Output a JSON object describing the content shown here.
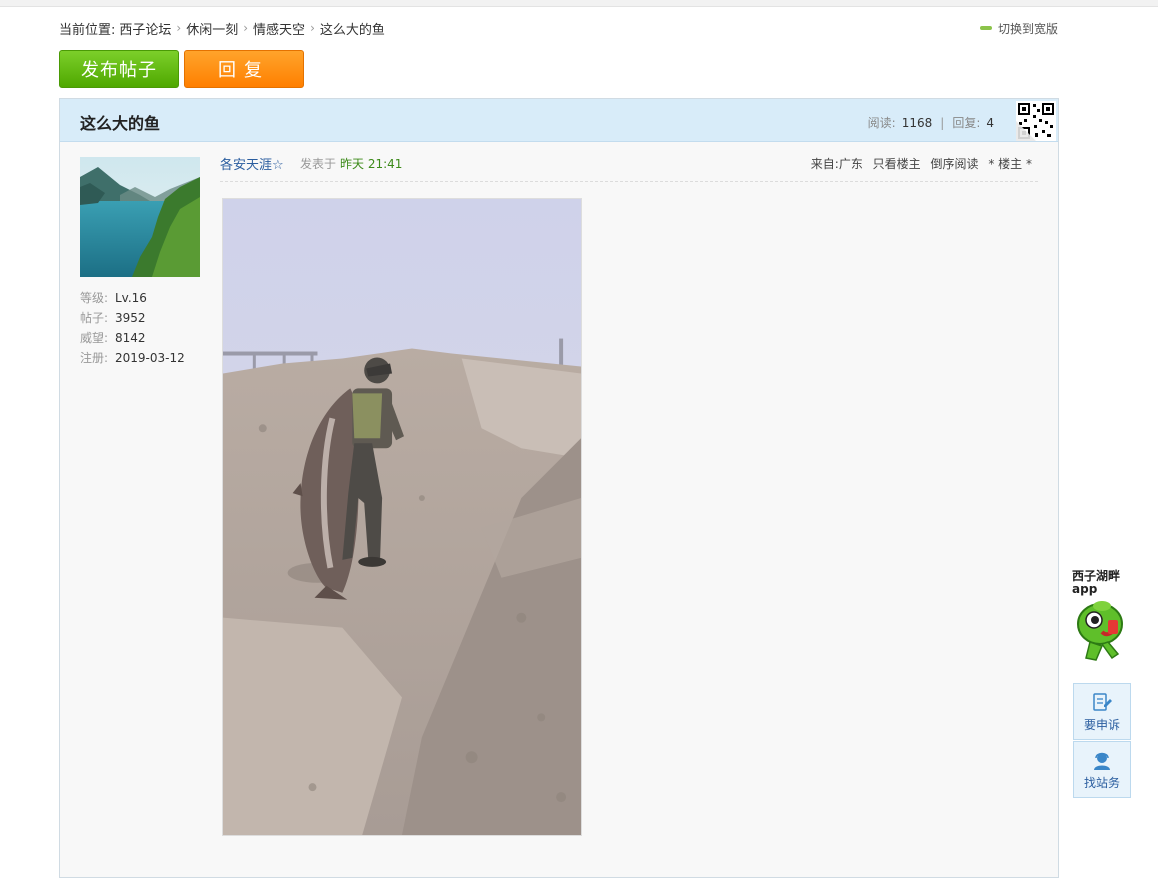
{
  "breadcrumb": {
    "prefix": "当前位置:",
    "items": [
      "西子论坛",
      "休闲一刻",
      "情感天空",
      "这么大的鱼"
    ]
  },
  "wide_mode_label": "切换到宽版",
  "buttons": {
    "post": "发布帖子",
    "reply": "回复"
  },
  "thread": {
    "title": "这么大的鱼",
    "views_label": "阅读:",
    "views": "1168",
    "replies_label": "回复:",
    "replies": "4"
  },
  "user": {
    "level_label": "等级:",
    "level": "Lv.16",
    "posts_label": "帖子:",
    "posts": "3952",
    "prestige_label": "威望:",
    "prestige": "8142",
    "registered_label": "注册:",
    "registered": "2019-03-12"
  },
  "post": {
    "author": "各安天涯☆",
    "posted_label": "发表于",
    "posted_time": "昨天 21:41",
    "source": "来自:广东",
    "only_author": "只看楼主",
    "reverse_read": "倒序阅读",
    "floor": "* 楼主 *"
  },
  "sidebar": {
    "app_title_line1": "西子湖畔",
    "app_title_line2": "app",
    "complain": "要申诉",
    "contact": "找站务"
  },
  "colors": {
    "post_button": "#5cb40d",
    "reply_button": "#ff8c0a",
    "header_bg": "#d8ecf9",
    "link": "#2a5d9f"
  }
}
